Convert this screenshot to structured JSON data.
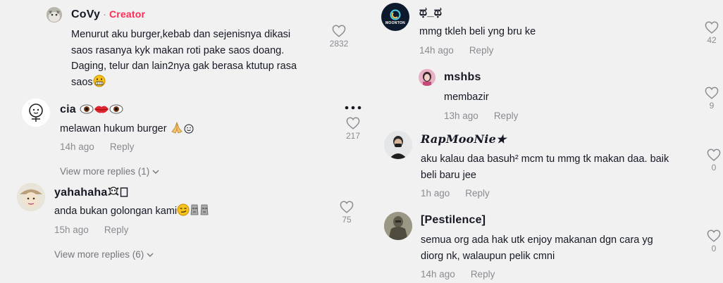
{
  "colors": {
    "creator": "#fe2c55",
    "muted": "#8a8b91",
    "text": "#161823",
    "background": "#f1f1f2"
  },
  "left": {
    "covy": {
      "username": "CoVy",
      "separator": "·",
      "badge": "Creator",
      "lines": [
        "Menurut aku burger,kebab dan sejenisnya dikasi",
        "saos rasanya kyk makan roti pake saos doang.",
        "Daging, telur dan lain2nya gak berasa ktutup rasa",
        "saos"
      ],
      "like_count": "2832"
    },
    "cia": {
      "username": "cia",
      "text": "melawan hukum burger",
      "time": "14h ago",
      "reply_label": "Reply",
      "like_count": "217",
      "view_more": "View more replies (1)"
    },
    "yahahaha": {
      "username": "yahahaha",
      "text": "anda bukan golongan kami",
      "time": "15h ago",
      "reply_label": "Reply",
      "like_count": "75",
      "view_more": "View more replies (6)"
    }
  },
  "right": {
    "tha": {
      "username": "ಥ_ಥ",
      "avatar_text": "MOONTON",
      "text": "mmg tkleh beli yng bru ke",
      "time": "14h ago",
      "reply_label": "Reply",
      "like_count": "42"
    },
    "mshbs": {
      "username": "mshbs",
      "text": "membazir",
      "time": "13h ago",
      "reply_label": "Reply",
      "like_count": "9"
    },
    "rapmoonie": {
      "username": "RapMooNie★",
      "lines": [
        "aku kalau daa basuh² mcm tu mmg tk makan daa. baik",
        "beli baru jee"
      ],
      "time": "1h ago",
      "reply_label": "Reply",
      "like_count": "0"
    },
    "pestilence": {
      "username": "[Pestilence]",
      "lines": [
        "semua org ada hak utk enjoy makanan dgn cara yg",
        "diorg nk, walaupun pelik cmni"
      ],
      "time": "14h ago",
      "reply_label": "Reply",
      "like_count": "0"
    }
  }
}
